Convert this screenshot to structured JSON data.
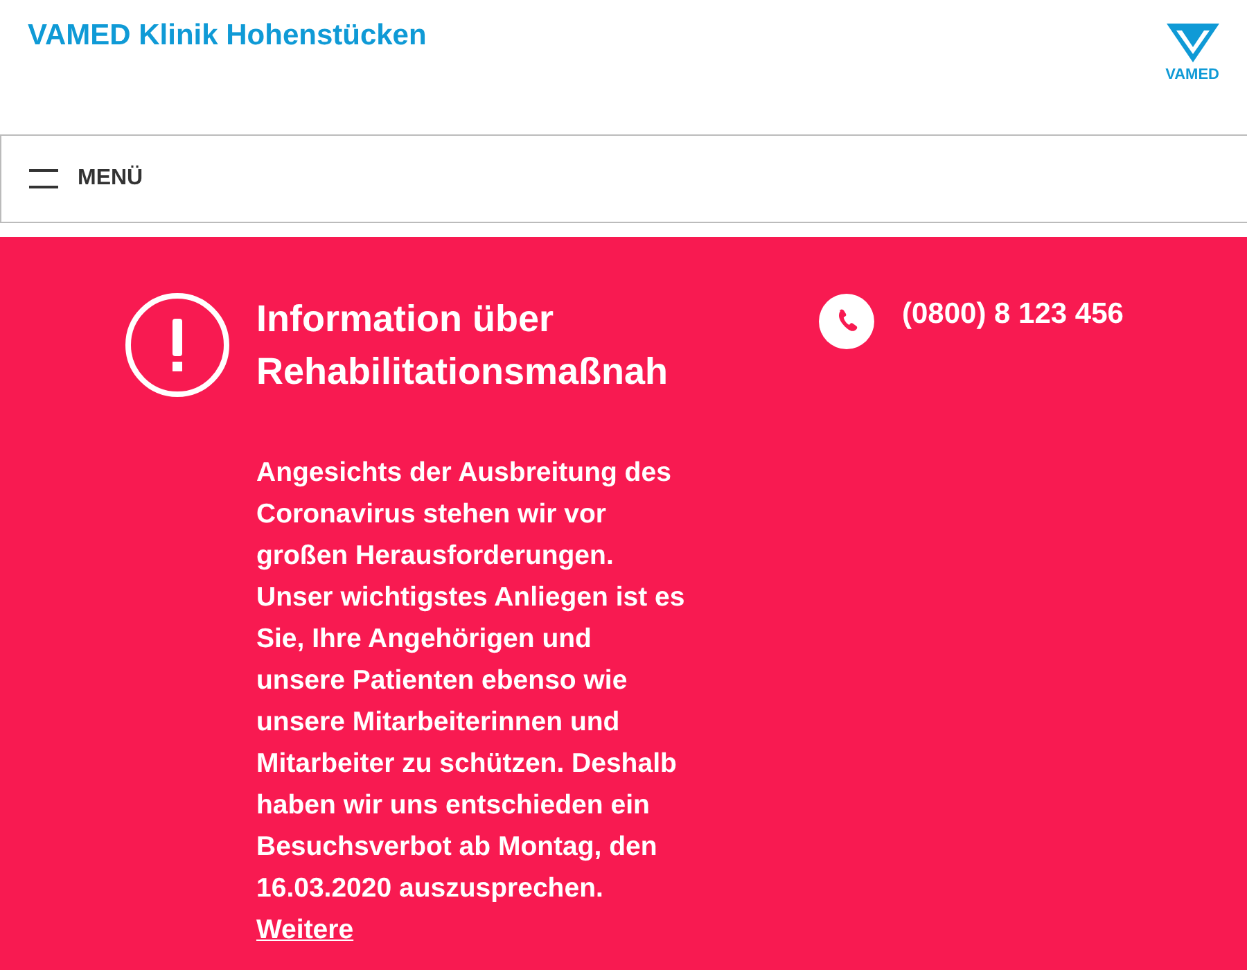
{
  "header": {
    "site_title": "VAMED Klinik Hohenstücken",
    "logo_text": "VAMED"
  },
  "nav": {
    "menu_label": "MENÜ"
  },
  "notice": {
    "title": "Information über Rehabilitationsmaßnah",
    "body": "Angesichts der Ausbreitung des Coronavirus stehen wir vor großen Herausforderungen. Unser wichtigstes Anliegen ist es Sie, Ihre Angehörigen und unsere Patienten ebenso wie unsere Mitarbeiterinnen und Mitarbeiter zu schützen. Deshalb haben wir uns entschieden ein Besuchsverbot ab Montag, den 16.03.2020 auszusprechen.",
    "link": "Weitere"
  },
  "contact": {
    "phone": "(0800) 8 123 456"
  }
}
